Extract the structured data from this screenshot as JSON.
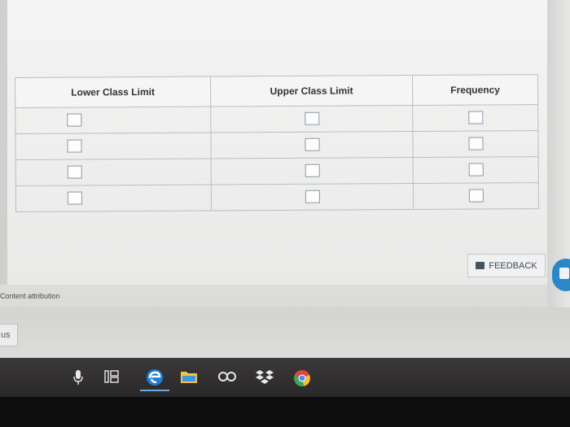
{
  "table": {
    "headers": [
      "Lower Class Limit",
      "Upper Class Limit",
      "Frequency"
    ],
    "rows": 4
  },
  "feedback": {
    "label": "FEEDBACK"
  },
  "attribution": {
    "label": "Content attribution"
  },
  "footer": {
    "partial_text": "us"
  },
  "taskbar": {
    "icons": [
      "microphone-icon",
      "task-view-icon",
      "edge-browser-icon",
      "file-explorer-icon",
      "infinity-app-icon",
      "dropbox-icon",
      "chrome-icon"
    ]
  },
  "colors": {
    "accent": "#2a87c9",
    "taskbar": "#2f2e2e"
  }
}
